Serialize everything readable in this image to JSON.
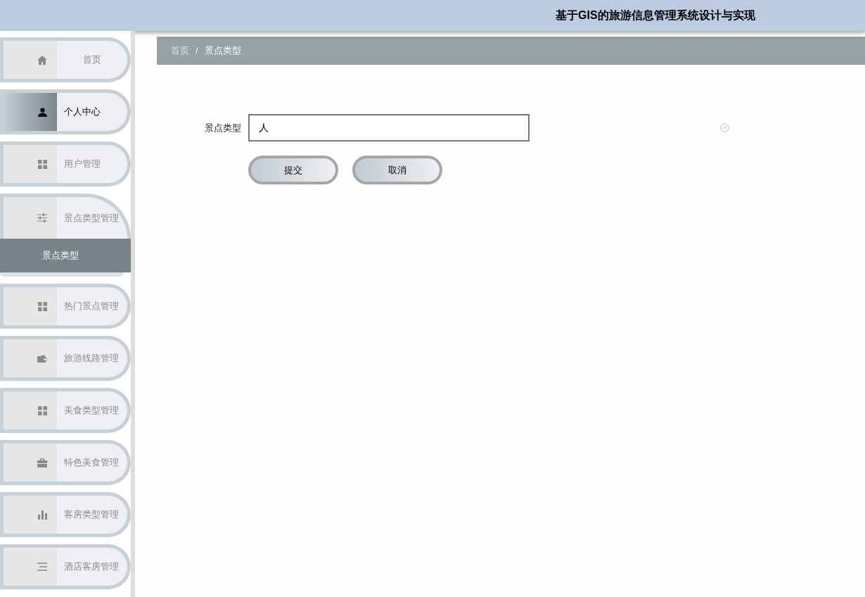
{
  "header": {
    "title": "基于GIS的旅游信息管理系统设计与实现"
  },
  "sidebar": {
    "items": [
      {
        "label": "首页",
        "selected": false,
        "expanded": false
      },
      {
        "label": "个人中心",
        "selected": true,
        "expanded": false
      },
      {
        "label": "用户管理",
        "selected": false,
        "expanded": false
      },
      {
        "label": "景点类型管理",
        "selected": false,
        "expanded": true,
        "children": [
          {
            "label": "景点类型",
            "selected": true
          }
        ]
      },
      {
        "label": "热门景点管理",
        "selected": false,
        "expanded": false
      },
      {
        "label": "旅游线路管理",
        "selected": false,
        "expanded": false
      },
      {
        "label": "美食类型管理",
        "selected": false,
        "expanded": false
      },
      {
        "label": "特色美食管理",
        "selected": false,
        "expanded": false
      },
      {
        "label": "客房类型管理",
        "selected": false,
        "expanded": false
      },
      {
        "label": "酒店客房管理",
        "selected": false,
        "expanded": false
      }
    ]
  },
  "breadcrumb": {
    "items": [
      {
        "label": "首页",
        "current": false
      },
      {
        "label": "景点类型",
        "current": true
      }
    ],
    "separator": "/"
  },
  "form": {
    "fields": [
      {
        "label": "景点类型",
        "value": "人"
      }
    ],
    "buttons": [
      {
        "label": "提交"
      },
      {
        "label": "取消"
      }
    ]
  }
}
